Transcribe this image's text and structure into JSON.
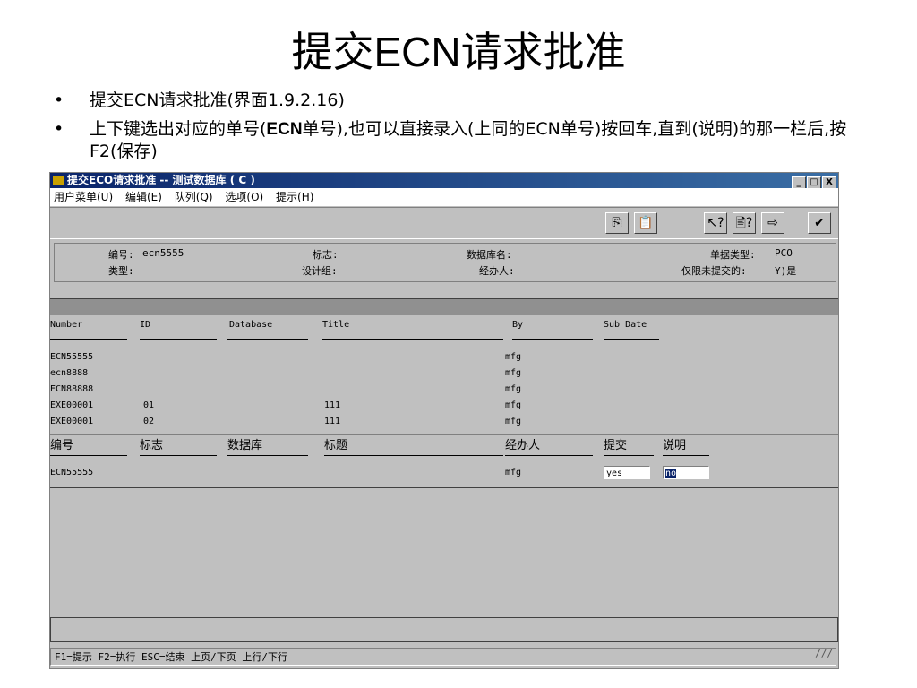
{
  "slide": {
    "title_cn1": "提交",
    "title_latin": "ECN",
    "title_cn2": "请求批准",
    "bullet1": "提交ECN请求批准(界面1.9.2.16)",
    "bullet2_a": "上下键选出对应的单号(",
    "bullet2_b": "ECN",
    "bullet2_c": "单号),也可以直接录入(上同的ECN单号)按回车,直到(说明)的那一栏后,按F2(保存)"
  },
  "window": {
    "title": "提交ECO请求批准 -- 测试数据库 ( C )",
    "controls": [
      "_",
      "□",
      "X"
    ]
  },
  "menu": [
    "用户菜单(U)",
    "编辑(E)",
    "队列(Q)",
    "选项(O)",
    "提示(H)"
  ],
  "toolbar": {
    "icons": [
      "copy-icon",
      "paste-icon",
      "help-icon",
      "help-query-icon",
      "export-icon",
      "approve-icon"
    ],
    "glyphs": [
      "⎘",
      "📋",
      "↖?",
      "🖹?",
      "⇨",
      "✔"
    ]
  },
  "header": {
    "number_label": "编号:",
    "number_value": "ecn5555",
    "flag_label": "标志:",
    "flag_value": "",
    "db_label": "数据库名:",
    "db_value": "",
    "doctype_label": "单据类型:",
    "doctype_value": "PCO",
    "type_label": "类型:",
    "type_value": "",
    "group_label": "设计组:",
    "group_value": "",
    "handler_label": "经办人:",
    "handler_value": "",
    "unsubmitted_label": "仅限未提交的:",
    "unsubmitted_value": "Y)是"
  },
  "grid": {
    "headers": [
      "Number",
      "ID",
      "Database",
      "Title",
      "By",
      "Sub Date"
    ],
    "rows": [
      [
        "ECN55555",
        "",
        "",
        "",
        "mfg",
        ""
      ],
      [
        "ecn8888",
        "",
        "",
        "",
        "mfg",
        ""
      ],
      [
        "ECN88888",
        "",
        "",
        "",
        "mfg",
        ""
      ],
      [
        "EXE00001",
        "01",
        "",
        "111",
        "mfg",
        ""
      ],
      [
        "EXE00001",
        "02",
        "",
        "111",
        "mfg",
        ""
      ]
    ]
  },
  "details": {
    "headers": [
      "编号",
      "标志",
      "数据库",
      "标题",
      "经办人",
      "提交",
      "说明"
    ],
    "row": {
      "number": "ECN55555",
      "handler": "mfg",
      "submit": "yes",
      "note": "no"
    }
  },
  "status": "F1=提示 F2=执行 ESC=结束 上页/下页 上行/下行"
}
